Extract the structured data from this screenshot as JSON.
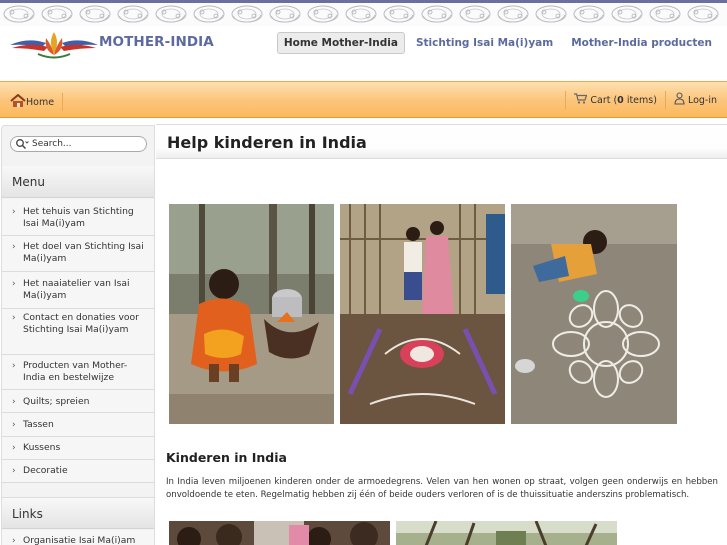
{
  "site": {
    "name": "MOTHER-INDIA"
  },
  "top_nav": [
    {
      "label": "Home Mother-India",
      "active": true
    },
    {
      "label": "Stichting Isai Ma(i)yam",
      "active": false
    },
    {
      "label": "Mother-India producten",
      "active": false
    }
  ],
  "toolbar": {
    "home_label": "Home",
    "cart_prefix": "Cart (",
    "cart_count": "0",
    "cart_suffix": " items)",
    "login_label": "Log-in"
  },
  "sidebar": {
    "search_placeholder": "Search...",
    "menu_title": "Menu",
    "menu_items": [
      {
        "label": "Het tehuis van Stichting Isai Ma(i)yam"
      },
      {
        "label": "Het doel van Stichting Isai Ma(i)yam"
      },
      {
        "label": "Het naaiatelier van Isai Ma(i)yam"
      },
      {
        "label": "Contact en donaties voor Stichting Isai Ma(i)yam"
      },
      {
        "label": "Producten van Mother-India en bestelwijze"
      },
      {
        "label": "Quilts; spreien"
      },
      {
        "label": "Tassen"
      },
      {
        "label": "Kussens"
      },
      {
        "label": "Decoratie"
      }
    ],
    "links_title": "Links",
    "links_items": [
      {
        "label": "Organisatie Isai Ma(i)am"
      }
    ]
  },
  "main": {
    "title": "Help kinderen in India",
    "section_title": "Kinderen in India",
    "paragraph": "In India leven miljoenen kinderen onder de armoedegrens. Velen van hen wonen op straat, volgen geen onderwijs en hebben onvoldoende te eten. Regelmatig hebben zij één of beide ouders verloren of is de thuissituatie anderszins problematisch."
  },
  "colors": {
    "accent_blue": "#5c6aa0",
    "toolbar_orange": "#fcc479"
  },
  "icons": {
    "home": "home-icon",
    "cart": "cart-icon",
    "login": "user-lock-icon",
    "search": "search-icon",
    "chevron": "chevron-right-icon"
  }
}
